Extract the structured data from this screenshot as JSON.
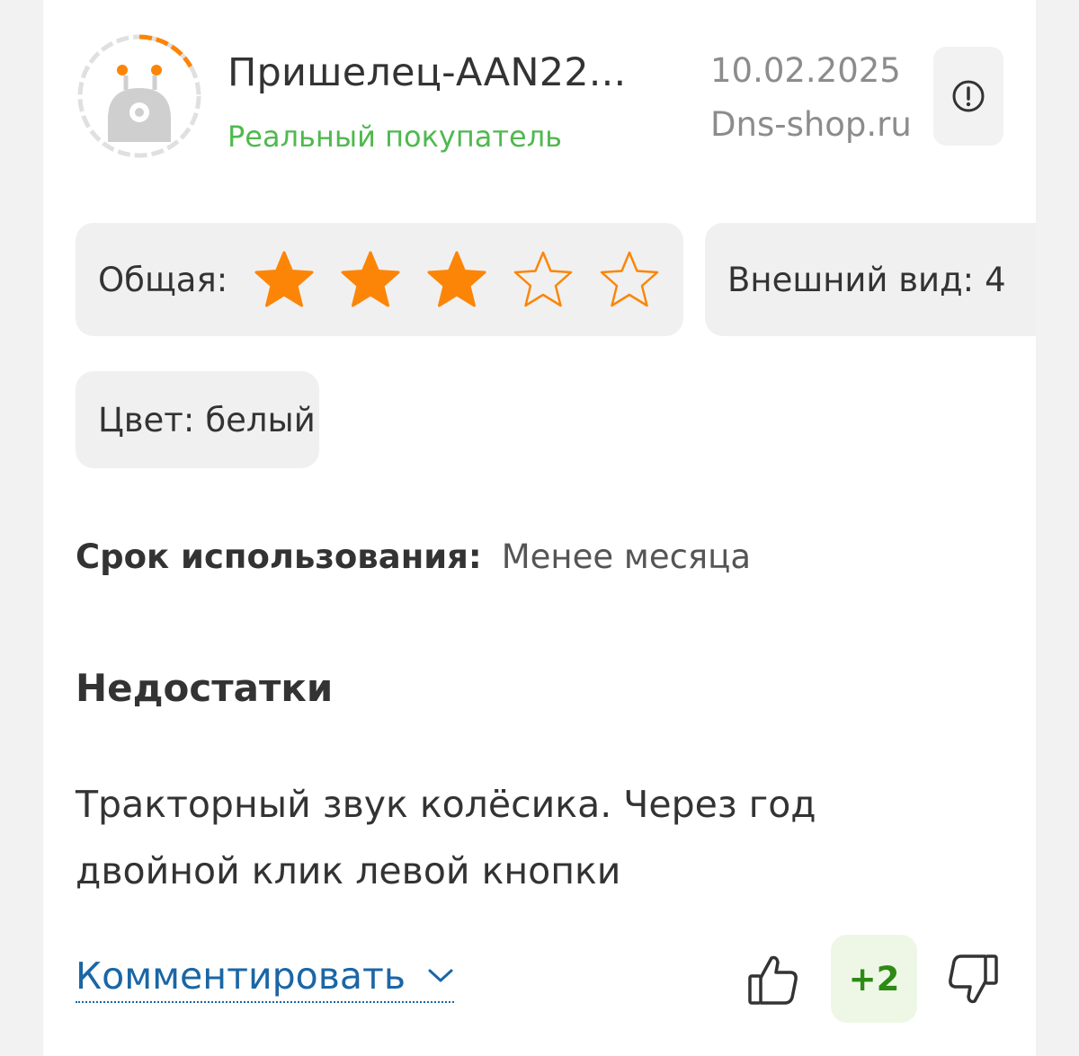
{
  "author": {
    "name": "Пришелец-AAN22...",
    "status": "Реальный покупатель"
  },
  "meta": {
    "date": "10.02.2025",
    "source": "Dns-shop.ru"
  },
  "ratings": {
    "overall_label": "Общая:",
    "overall_stars": 3,
    "overall_max": 5,
    "appearance_label": "Внешний вид:",
    "appearance_value": "4",
    "color_label": "Цвет:",
    "color_value": "белый"
  },
  "usage": {
    "label": "Срок использования:",
    "value": "Менее месяца"
  },
  "cons": {
    "title": "Недостатки",
    "text": "Тракторный звук колёсика. Через год двойной клик левой кнопки"
  },
  "actions": {
    "comment_label": "Комментировать",
    "vote_count": "+2"
  },
  "colors": {
    "star_orange": "#fc8507",
    "status_green": "#4fb94f",
    "link_blue": "#1a66a6",
    "vote_green": "#2e8a16"
  },
  "icons": [
    "alien-avatar-icon",
    "report-icon",
    "star-icon",
    "chevron-down-icon",
    "thumbs-up-icon",
    "thumbs-down-icon"
  ]
}
